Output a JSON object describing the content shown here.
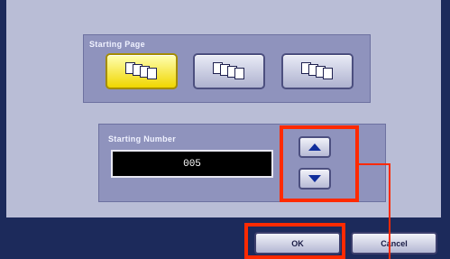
{
  "starting_page": {
    "label": "Starting Page",
    "options": [
      {
        "name": "option-1",
        "selected": true
      },
      {
        "name": "option-2",
        "selected": false
      },
      {
        "name": "option-3",
        "selected": false
      }
    ]
  },
  "starting_number": {
    "label": "Starting Number",
    "value": "005"
  },
  "buttons": {
    "ok": "OK",
    "cancel": "Cancel"
  },
  "colors": {
    "highlight": "#ff2a00",
    "selected_option": "#f0d600",
    "arrow": "#0f2d9c"
  }
}
